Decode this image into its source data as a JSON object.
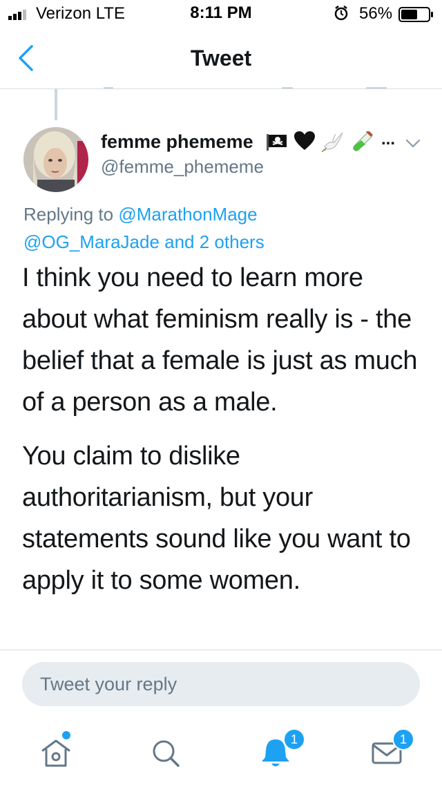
{
  "status_bar": {
    "carrier": "Verizon  LTE",
    "time": "8:11 PM",
    "battery": "56%"
  },
  "nav": {
    "title": "Tweet"
  },
  "tweet": {
    "author_name": "femme phememe",
    "name_emojis": [
      "pirate-flag",
      "black-heart",
      "dove",
      "test-tube"
    ],
    "more": "...",
    "handle": "@femme_phememe",
    "replying_prefix": "Replying to ",
    "replying_user": "@MarathonMage",
    "replying_others": "@OG_MaraJade and 2 others",
    "paragraphs": [
      "I think you need to learn more about what feminism really is - the belief that a female is just as much of a person as a male.",
      "You claim to dislike authoritarianism, but your statements sound like you want to apply it to some women."
    ]
  },
  "reply": {
    "placeholder": "Tweet your reply"
  },
  "tabs": {
    "notifications_badge": "1",
    "messages_badge": "1"
  },
  "colors": {
    "accent": "#1da1f2",
    "secondary_text": "#657786",
    "primary_text": "#14171a",
    "reply_bg": "#e6ecf0"
  }
}
